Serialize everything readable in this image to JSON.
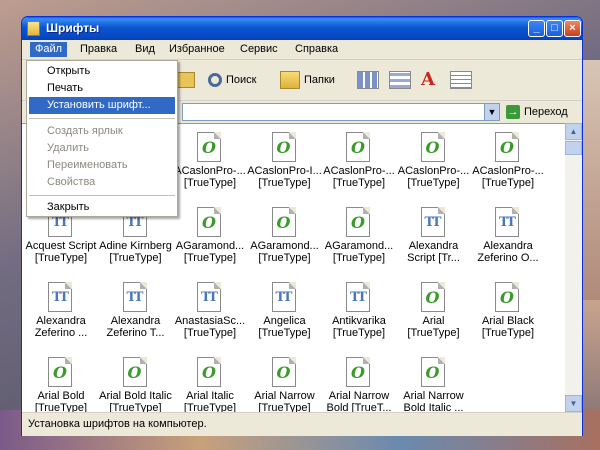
{
  "window": {
    "title": "Шрифты"
  },
  "menubar": [
    "Файл",
    "Правка",
    "Вид",
    "Избранное",
    "Сервис",
    "Справка"
  ],
  "toolbar": {
    "search": "Поиск",
    "folders": "Папки"
  },
  "addressbar": {
    "value": "",
    "go": "Переход"
  },
  "file_menu": {
    "items": [
      "Открыть",
      "Печать",
      "Установить шрифт...",
      "Создать ярлык",
      "Удалить",
      "Переименовать",
      "Свойства",
      "Закрыть"
    ]
  },
  "fonts": [
    {
      "l1": "ACaslonPro-...",
      "l2": "[TrueType]",
      "t": "o"
    },
    {
      "l1": "ACaslonPro-...",
      "l2": "[TrueType]",
      "t": "o"
    },
    {
      "l1": "ACaslonPro-I...",
      "l2": "[TrueType]",
      "t": "o"
    },
    {
      "l1": "ACaslonPro-...",
      "l2": "[TrueType]",
      "t": "o"
    },
    {
      "l1": "ACaslonPro-...",
      "l2": "[TrueType]",
      "t": "o"
    },
    {
      "l1": "ACaslonPro-...",
      "l2": "[TrueType]",
      "t": "o"
    },
    {
      "l1": "Acquest Script",
      "l2": "[TrueType]",
      "t": "t"
    },
    {
      "l1": "Adine Kirnberg",
      "l2": "[TrueType]",
      "t": "t"
    },
    {
      "l1": "AGaramond...",
      "l2": "[TrueType]",
      "t": "o"
    },
    {
      "l1": "AGaramond...",
      "l2": "[TrueType]",
      "t": "o"
    },
    {
      "l1": "AGaramond...",
      "l2": "[TrueType]",
      "t": "o"
    },
    {
      "l1": "Alexandra",
      "l2": "Script [Tr...",
      "t": "t"
    },
    {
      "l1": "Alexandra",
      "l2": "Zeferino O...",
      "t": "t"
    },
    {
      "l1": "Alexandra",
      "l2": "Zeferino ...",
      "t": "t"
    },
    {
      "l1": "Alexandra",
      "l2": "Zeferino T...",
      "t": "t"
    },
    {
      "l1": "AnastasiaSc...",
      "l2": "[TrueType]",
      "t": "t"
    },
    {
      "l1": "Angelica",
      "l2": "[TrueType]",
      "t": "t"
    },
    {
      "l1": "Antikvarika",
      "l2": "[TrueType]",
      "t": "t"
    },
    {
      "l1": "Arial",
      "l2": "[TrueType]",
      "t": "o"
    },
    {
      "l1": "Arial Black",
      "l2": "[TrueType]",
      "t": "o"
    },
    {
      "l1": "Arial Bold",
      "l2": "[TrueType]",
      "t": "o"
    },
    {
      "l1": "Arial Bold Italic",
      "l2": "[TrueType]",
      "t": "o"
    },
    {
      "l1": "Arial Italic",
      "l2": "[TrueType]",
      "t": "o"
    },
    {
      "l1": "Arial Narrow",
      "l2": "[TrueType]",
      "t": "o"
    },
    {
      "l1": "Arial Narrow",
      "l2": "Bold [TrueT...",
      "t": "o"
    },
    {
      "l1": "Arial Narrow",
      "l2": "Bold Italic ...",
      "t": "o"
    }
  ],
  "statusbar": {
    "text": "Установка шрифтов на компьютер."
  }
}
